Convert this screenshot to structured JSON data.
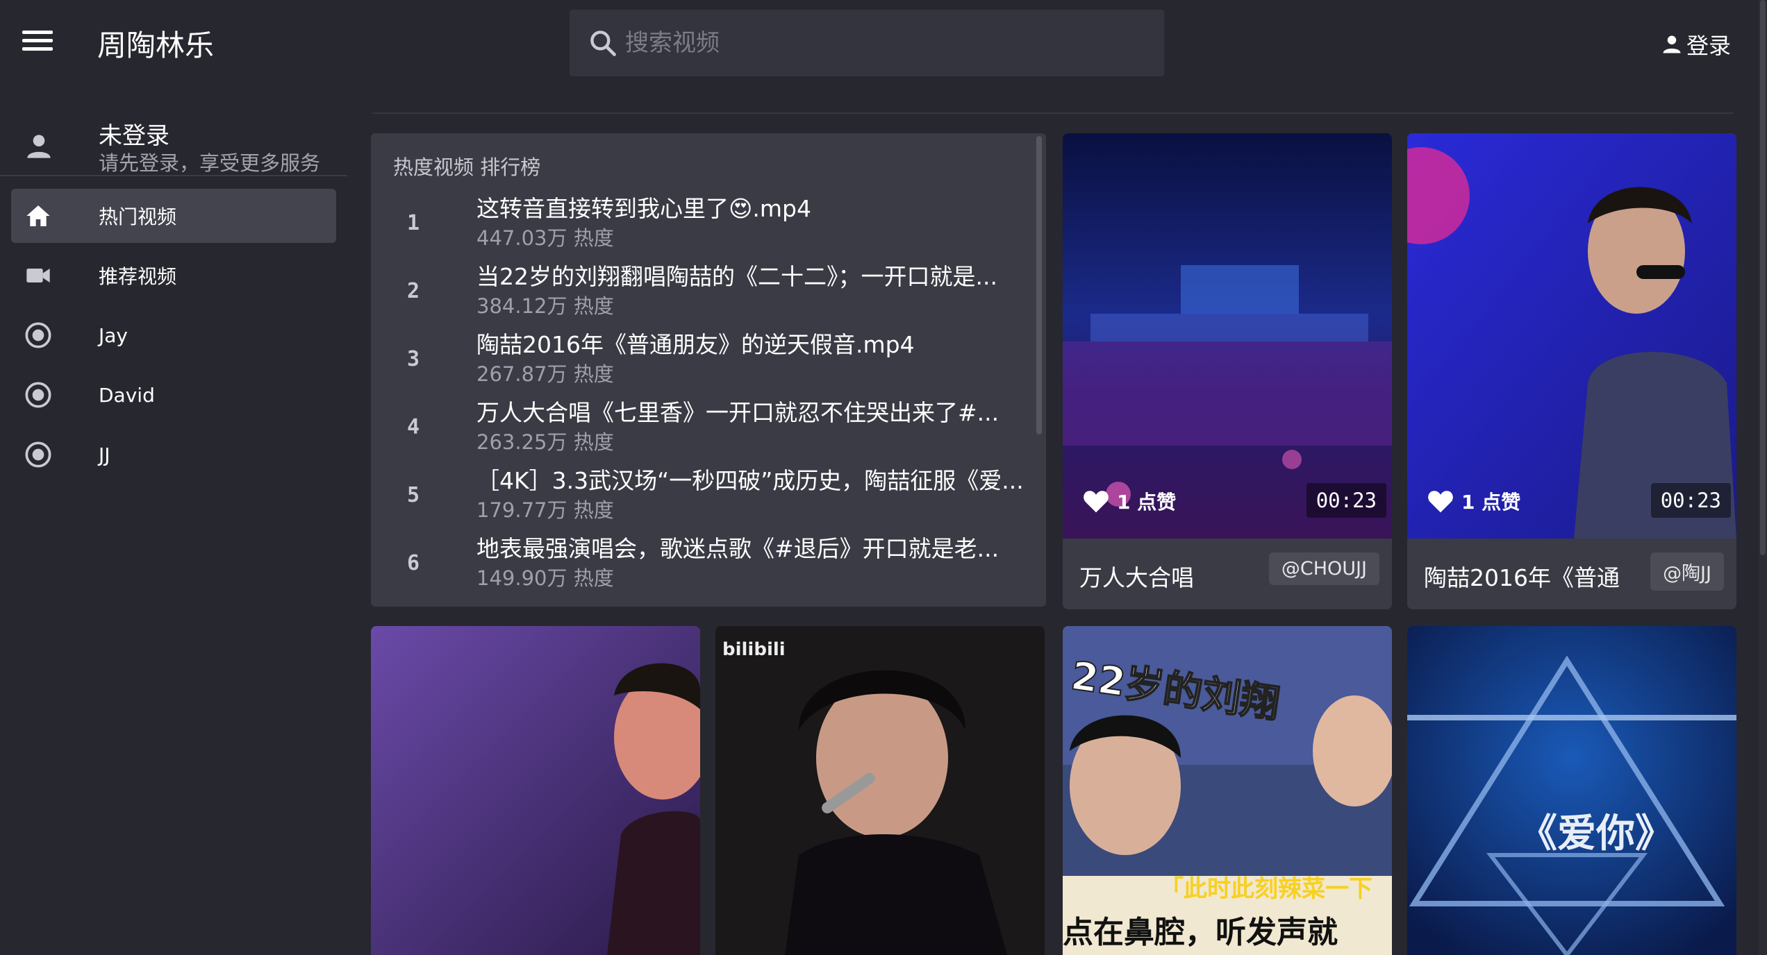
{
  "app": {
    "title": "周陶林乐",
    "accent": "#ffffff",
    "background": "#27272f"
  },
  "search": {
    "placeholder": "搜索视频",
    "icon": "search-icon"
  },
  "header": {
    "login_label": "登录",
    "menu_icon": "menu-icon",
    "login_icon": "user-icon"
  },
  "user": {
    "name": "未登录",
    "subtitle": "请先登录，享受更多服务",
    "icon": "avatar-icon"
  },
  "sidebar": {
    "items": [
      {
        "label": "热门视频",
        "icon": "home-icon",
        "active": true
      },
      {
        "label": "推荐视频",
        "icon": "video-camera-icon",
        "active": false
      },
      {
        "label": "Jay",
        "icon": "radio-icon",
        "active": false
      },
      {
        "label": "David",
        "icon": "radio-icon",
        "active": false
      },
      {
        "label": "JJ",
        "icon": "radio-icon",
        "active": false
      }
    ]
  },
  "ranking": {
    "title": "热度视频 排行榜",
    "items": [
      {
        "rank": "1",
        "title": "这转音直接转到我心里了😍.mp4",
        "heat": "447.03万 热度"
      },
      {
        "rank": "2",
        "title": "当22岁的刘翔翻唱陶喆的《二十二》；一开口就是...",
        "heat": "384.12万 热度"
      },
      {
        "rank": "3",
        "title": "陶喆2016年《普通朋友》的逆天假音.mp4",
        "heat": "267.87万 热度"
      },
      {
        "rank": "4",
        "title": "万人大合唱《七里香》一开口就忍不住哭出来了#...",
        "heat": "263.25万 热度"
      },
      {
        "rank": "5",
        "title": "［4K］3.3武汉场“一秒四破”成历史，陶喆征服《爱...",
        "heat": "179.77万 热度"
      },
      {
        "rank": "6",
        "title": "地表最强演唱会，歌迷点歌《#退后》开口就是老...",
        "heat": "149.90万 热度"
      }
    ]
  },
  "cards": [
    {
      "likes": "1 点赞",
      "duration": "00:23",
      "title": "万人大合唱",
      "author": "@CHOUJJ"
    },
    {
      "likes": "1 点赞",
      "duration": "00:23",
      "title": "陶喆2016年《普通",
      "author": "@陶JJ"
    }
  ],
  "bottom_cards": [
    {
      "overlay_text": ""
    },
    {
      "overlay_text": "bilibili"
    },
    {
      "overlay_text": "22岁的刘翔",
      "caption_line1": "「此时此刻辣菜一下",
      "caption_line2": "点在鼻腔，听发声就"
    },
    {
      "overlay_text": "《爱你》"
    }
  ]
}
